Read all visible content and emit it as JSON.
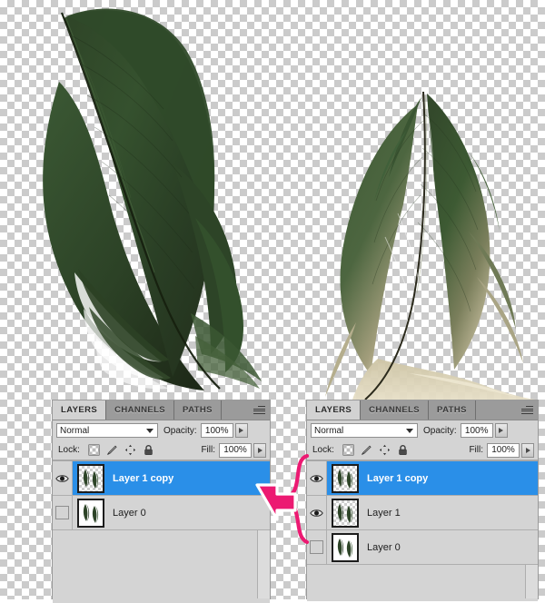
{
  "app": {
    "name": "Adobe Photoshop Layers Panel",
    "accent_selected": "#2a8fe8",
    "panel_bg": "#d4d4d4",
    "annotation_color": "#ec1a72",
    "canvas_bg": "transparent-checkerboard"
  },
  "canvas": {
    "left_image_name": "green-feather-single",
    "right_image_name": "green-feather-tan-tip"
  },
  "panels": [
    {
      "id": "before",
      "tabs": [
        {
          "label": "LAYERS",
          "active": true
        },
        {
          "label": "CHANNELS",
          "active": false
        },
        {
          "label": "PATHS",
          "active": false
        }
      ],
      "menu_icon": "panel-menu-icon",
      "blend_mode": "Normal",
      "opacity_label": "Opacity:",
      "opacity_value": "100%",
      "lock_label": "Lock:",
      "lock_icons": [
        "lock-transparent-pixels-icon",
        "lock-image-pixels-icon",
        "lock-position-icon",
        "lock-all-icon"
      ],
      "fill_label": "Fill:",
      "fill_value": "100%",
      "layers": [
        {
          "name": "Layer 1 copy",
          "visible": true,
          "selected": true,
          "thumb": "alpha"
        },
        {
          "name": "Layer 0",
          "visible": false,
          "selected": false,
          "thumb": "white"
        }
      ]
    },
    {
      "id": "after",
      "tabs": [
        {
          "label": "LAYERS",
          "active": true
        },
        {
          "label": "CHANNELS",
          "active": false
        },
        {
          "label": "PATHS",
          "active": false
        }
      ],
      "menu_icon": "panel-menu-icon",
      "blend_mode": "Normal",
      "opacity_label": "Opacity:",
      "opacity_value": "100%",
      "lock_label": "Lock:",
      "lock_icons": [
        "lock-transparent-pixels-icon",
        "lock-image-pixels-icon",
        "lock-position-icon",
        "lock-all-icon"
      ],
      "fill_label": "Fill:",
      "fill_value": "100%",
      "layers": [
        {
          "name": "Layer 1 copy",
          "visible": true,
          "selected": true,
          "thumb": "alpha"
        },
        {
          "name": "Layer 1",
          "visible": true,
          "selected": false,
          "thumb": "alpha"
        },
        {
          "name": "Layer 0",
          "visible": false,
          "selected": false,
          "thumb": "white"
        }
      ]
    }
  ],
  "annotations": {
    "arrow": "pink-left-arrow",
    "brace": "pink-curly-brace"
  }
}
